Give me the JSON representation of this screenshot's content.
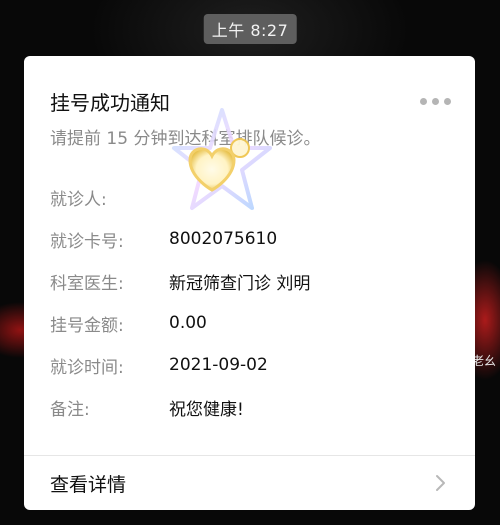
{
  "status_bar": {
    "time": "上午 8:27"
  },
  "card": {
    "title": "挂号成功通知",
    "subtitle": "请提前 15 分钟到达科室排队候诊。",
    "fields": [
      {
        "label": "就诊人:",
        "value": ""
      },
      {
        "label": "就诊卡号:",
        "value": "8002075610"
      },
      {
        "label": "科室医生:",
        "value": "新冠筛查门诊 刘明"
      },
      {
        "label": "挂号金额:",
        "value": "0.00"
      },
      {
        "label": "就诊时间:",
        "value": "2021-09-02"
      },
      {
        "label": "备注:",
        "value": "祝您健康!"
      }
    ],
    "details_label": "查看详情",
    "more_icon": "more-dots-icon",
    "chevron_icon": "chevron-right-icon"
  },
  "background": {
    "side_text": "老幺"
  },
  "sticker": {
    "icon": "heart-star-sticker-icon"
  },
  "colors": {
    "card_bg": "#ffffff",
    "label_gray": "#8a8a8a",
    "text_dark": "#111111",
    "time_badge_bg": "#5e5e5e"
  }
}
